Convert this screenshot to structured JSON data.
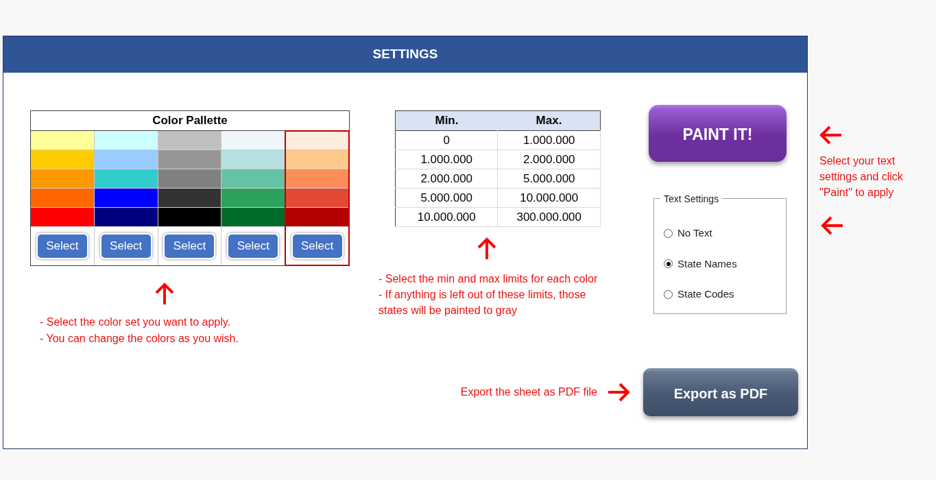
{
  "header": {
    "title": "SETTINGS"
  },
  "palette": {
    "title": "Color Pallette",
    "columns": [
      {
        "selected": false,
        "button": "Select",
        "swatches": [
          {
            "color": "#ffff99"
          },
          {
            "color": "#ffcc00"
          },
          {
            "color": "#ff9900"
          },
          {
            "color": "#ff6600"
          },
          {
            "color": "#ff0000"
          }
        ]
      },
      {
        "selected": false,
        "button": "Select",
        "swatches": [
          {
            "color": "#ccffff"
          },
          {
            "color": "#99ccff"
          },
          {
            "color": "#33cccc"
          },
          {
            "color": "#0000ff"
          },
          {
            "color": "#000080"
          }
        ]
      },
      {
        "selected": false,
        "button": "Select",
        "swatches": [
          {
            "color": "#c0c0c0"
          },
          {
            "color": "#969696"
          },
          {
            "color": "#808080"
          },
          {
            "color": "#333333"
          },
          {
            "color": "#000000"
          }
        ]
      },
      {
        "selected": false,
        "button": "Select",
        "swatches": [
          {
            "color": "#eef6fa"
          },
          {
            "color": "#b4e0df"
          },
          {
            "color": "#66c2a4"
          },
          {
            "color": "#2ca25f"
          },
          {
            "color": "#006d2c"
          }
        ]
      },
      {
        "selected": true,
        "button": "Select",
        "swatches": [
          {
            "color": "#feedde"
          },
          {
            "color": "#fdca8c"
          },
          {
            "color": "#fc8d59"
          },
          {
            "color": "#e34a33"
          },
          {
            "color": "#b30000"
          }
        ]
      }
    ],
    "notes": [
      "- Select the color set you want to apply.",
      "- You can change the colors as you wish."
    ]
  },
  "limits": {
    "columns": [
      "Min.",
      "Max."
    ],
    "rows": [
      [
        "0",
        "1.000.000"
      ],
      [
        "1.000.000",
        "2.000.000"
      ],
      [
        "2.000.000",
        "5.000.000"
      ],
      [
        "5.000.000",
        "10.000.000"
      ],
      [
        "10.000.000",
        "300.000.000"
      ]
    ],
    "notes": [
      "- Select the min and max limits for each color",
      "- If anything is left out of these limits, those states will be painted to gray"
    ]
  },
  "paint_button": "PAINT IT!",
  "text_settings": {
    "title": "Text Settings",
    "options": [
      {
        "label": "No Text",
        "selected": false
      },
      {
        "label": "State Names",
        "selected": true
      },
      {
        "label": "State Codes",
        "selected": false
      }
    ]
  },
  "side_note": "Select your text settings and click \"Paint\" to apply",
  "export": {
    "note": "Export the sheet as PDF file",
    "button": "Export as PDF"
  }
}
